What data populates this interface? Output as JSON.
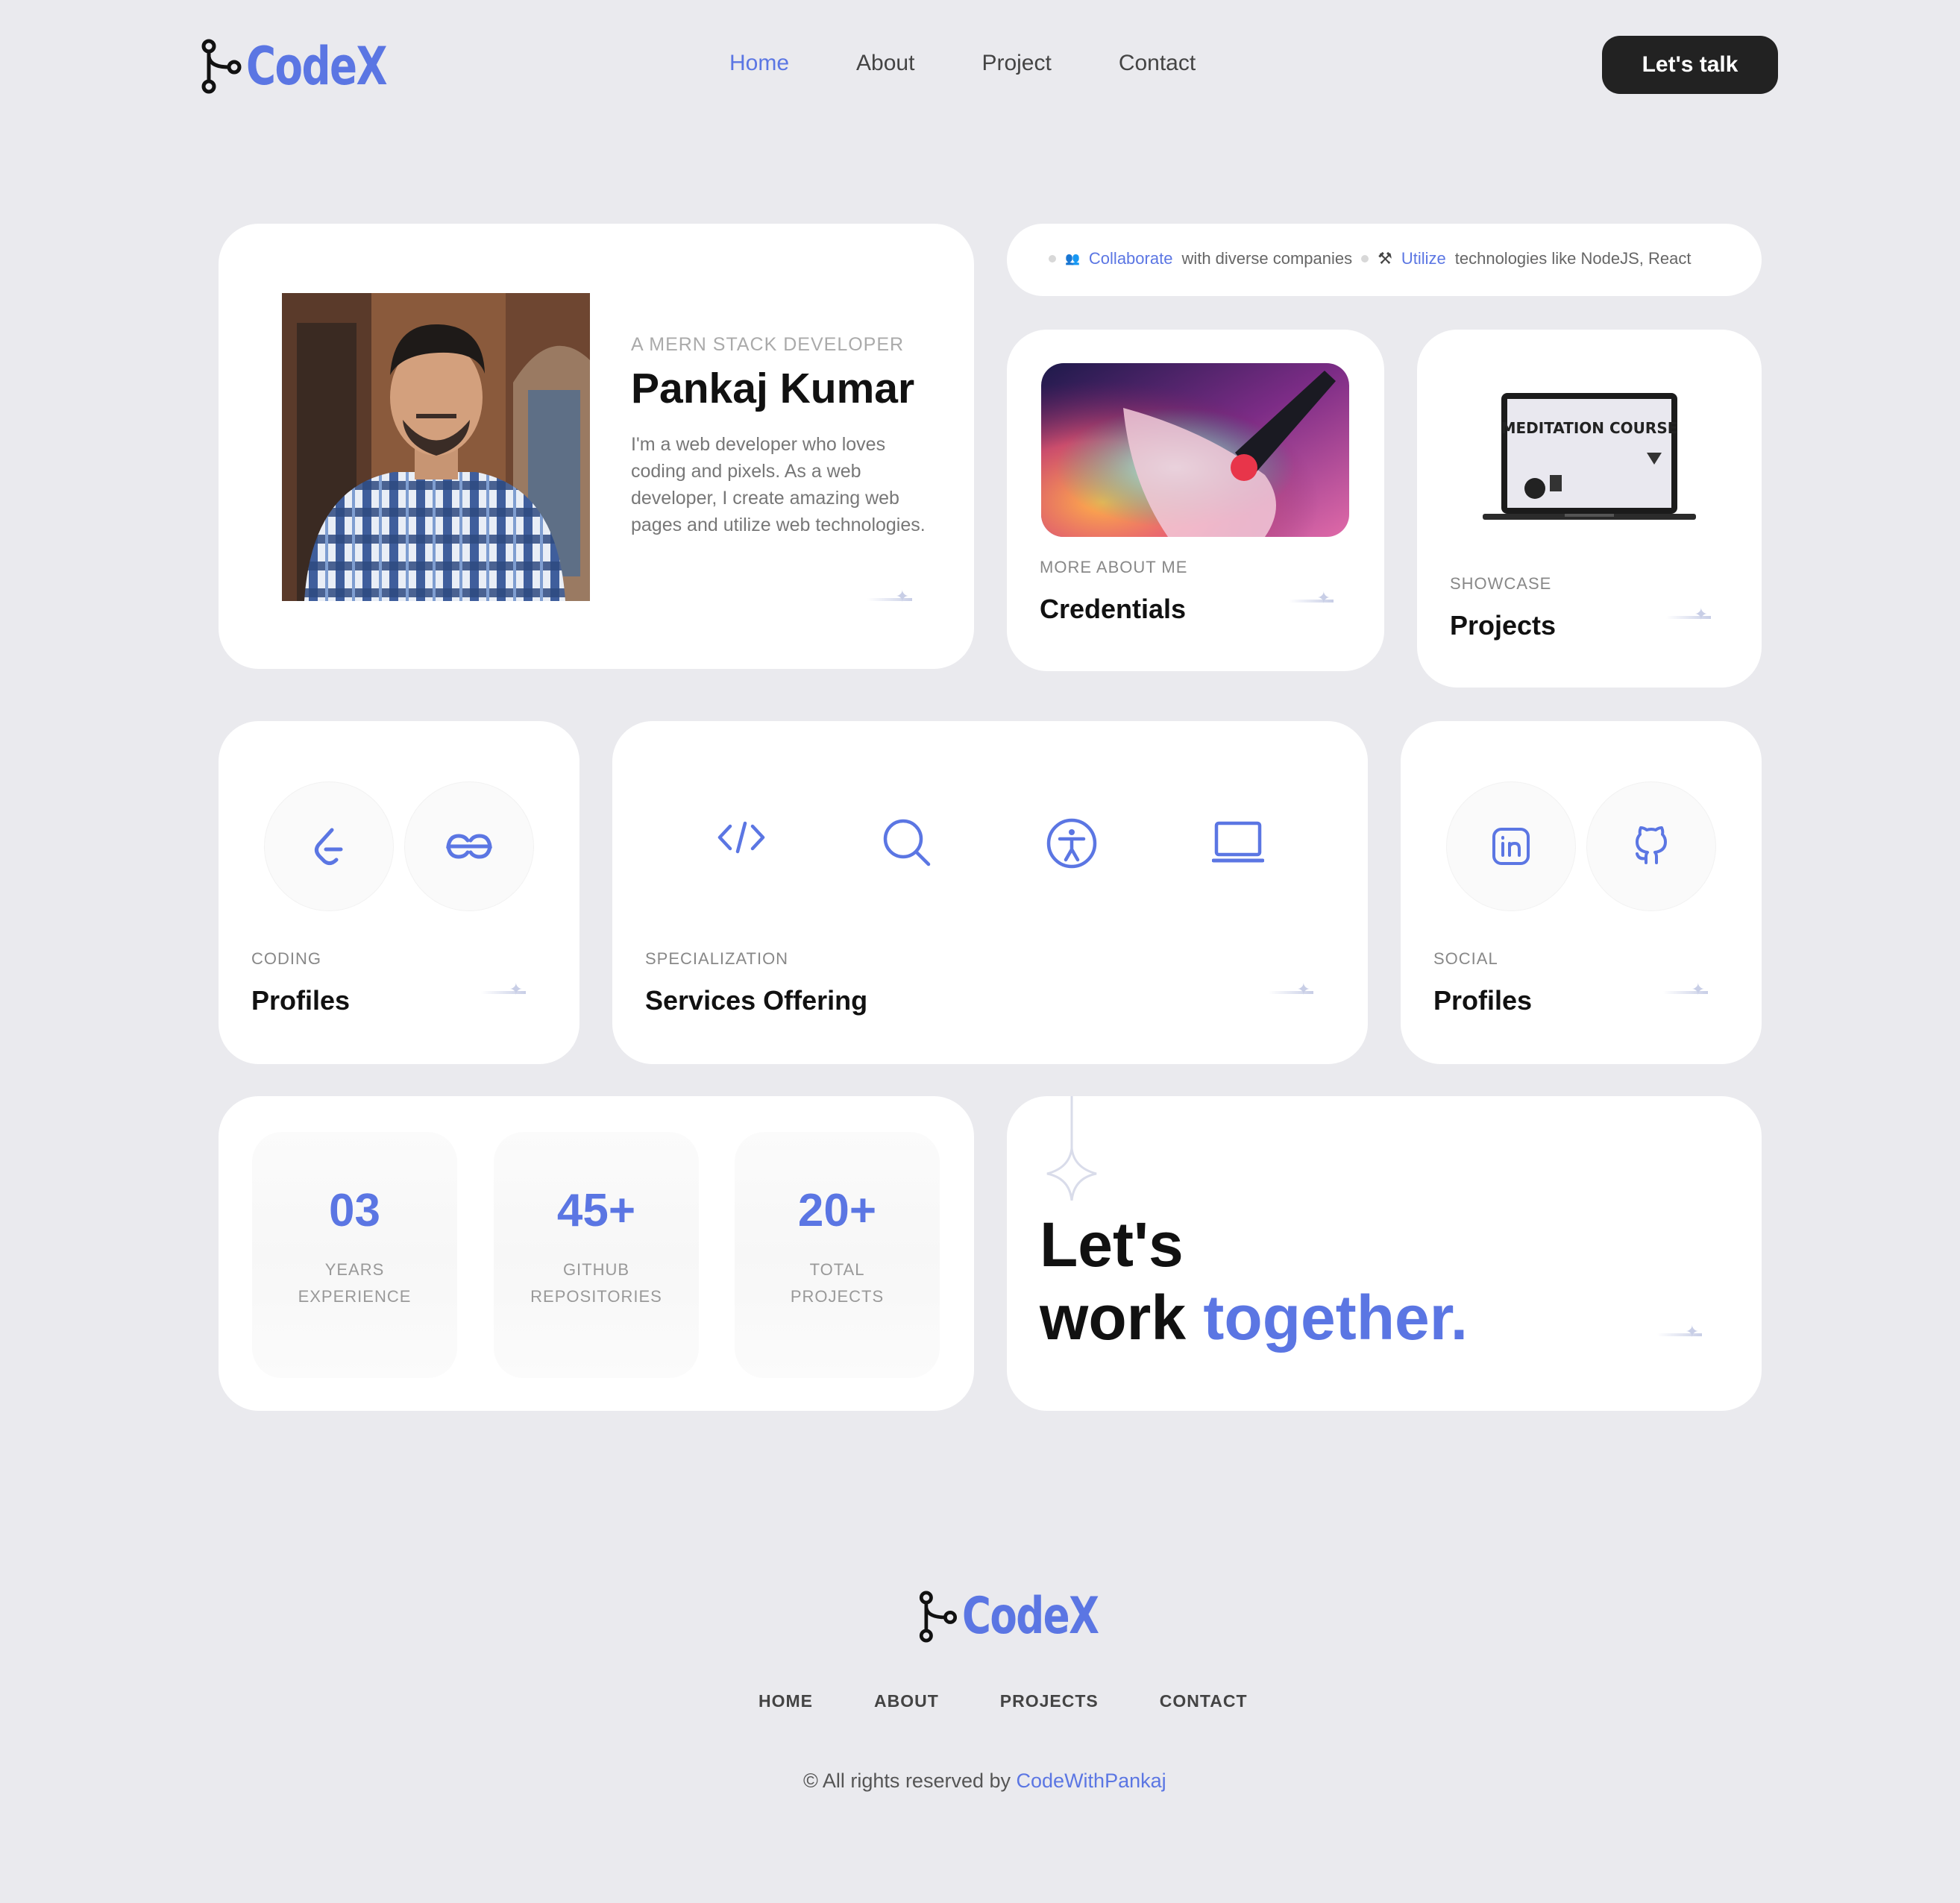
{
  "header": {
    "brand": "CodeX",
    "nav": [
      {
        "label": "Home",
        "active": true
      },
      {
        "label": "About",
        "active": false
      },
      {
        "label": "Project",
        "active": false
      },
      {
        "label": "Contact",
        "active": false
      }
    ],
    "cta_label": "Let's talk"
  },
  "profile_card": {
    "eyebrow": "A MERN STACK DEVELOPER",
    "name": "Pankaj Kumar",
    "bio": "I'm a web developer who loves coding and pixels. As a web developer, I create amazing web pages and utilize web technologies."
  },
  "ticker": {
    "item1_highlight": "Collaborate",
    "item1_text": "with diverse companies",
    "item2_highlight": "Utilize",
    "item2_text": "technologies like NodeJS, React"
  },
  "credentials_card": {
    "label": "MORE ABOUT ME",
    "title": "Credentials"
  },
  "projects_card": {
    "label": "SHOWCASE",
    "title": "Projects",
    "laptop_screen_text": "MEDITATION COURSE"
  },
  "coding_card": {
    "label": "CODING",
    "title": "Profiles",
    "icons": [
      "leetcode-icon",
      "geeksforgeeks-icon"
    ]
  },
  "services_card": {
    "label": "SPECIALIZATION",
    "title": "Services Offering",
    "icons": [
      "code-icon",
      "search-icon",
      "accessibility-icon",
      "laptop-icon"
    ]
  },
  "social_card": {
    "label": "SOCIAL",
    "title": "Profiles",
    "icons": [
      "linkedin-icon",
      "github-icon"
    ]
  },
  "stats": [
    {
      "value": "03",
      "line1": "YEARS",
      "line2": "EXPERIENCE"
    },
    {
      "value": "45+",
      "line1": "GITHUB",
      "line2": "REPOSITORIES"
    },
    {
      "value": "20+",
      "line1": "TOTAL",
      "line2": "PROJECTS"
    }
  ],
  "cta_card": {
    "line1": "Let's",
    "line2_prefix": "work",
    "line2_accent": "together."
  },
  "footer": {
    "brand": "CodeX",
    "nav": [
      "HOME",
      "ABOUT",
      "PROJECTS",
      "CONTACT"
    ],
    "copyright_prefix": "© All rights reserved by",
    "copyright_link": "CodeWithPankaj"
  },
  "colors": {
    "accent": "#5b76e3",
    "background": "#eaeaee",
    "card": "#ffffff",
    "cta_bg": "#222222"
  }
}
